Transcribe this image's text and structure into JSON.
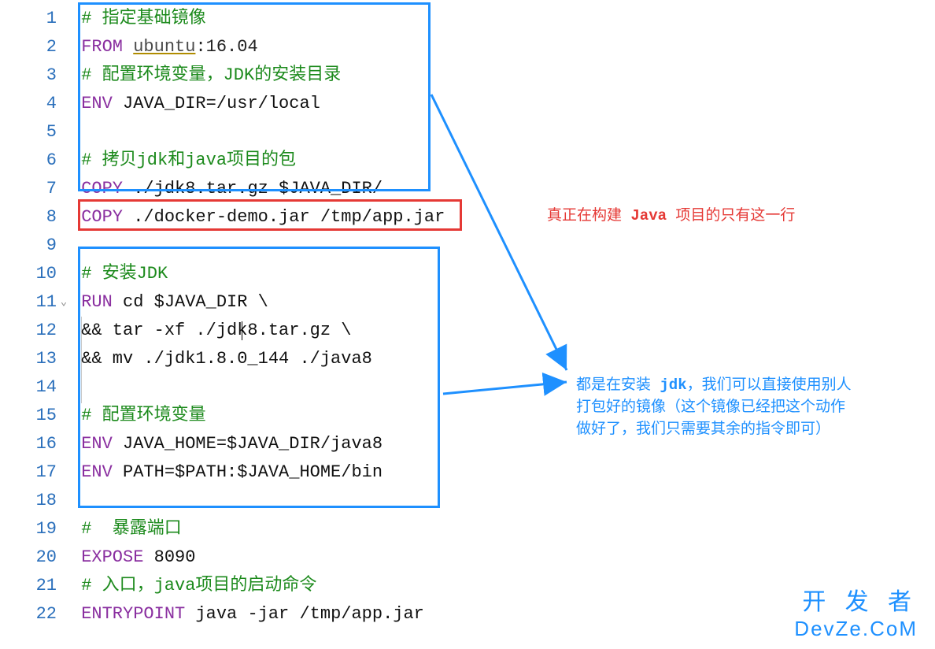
{
  "lineNumbers": [
    "1",
    "2",
    "3",
    "4",
    "5",
    "6",
    "7",
    "8",
    "9",
    "10",
    "11",
    "12",
    "13",
    "14",
    "15",
    "16",
    "17",
    "18",
    "19",
    "20",
    "21",
    "22"
  ],
  "code": {
    "l1_comment": "# 指定基础镜像",
    "l2_from": "FROM",
    "l2_image": "ubuntu",
    "l2_tag": ":16.04",
    "l3_comment": "# 配置环境变量，JDK的安装目录",
    "l4_env": "ENV",
    "l4_rest": " JAVA_DIR=/usr/local",
    "l6_comment": "# 拷贝jdk和java项目的包",
    "l7_copy": "COPY",
    "l7_rest": " ./jdk8.tar.gz $JAVA_DIR/",
    "l8_copy": "COPY",
    "l8_rest": " ./docker-demo.jar /tmp/app.jar",
    "l10_comment": "# 安装JDK",
    "l11_run": "RUN",
    "l11_rest": " cd $JAVA_DIR \\",
    "l12": " && tar -xf ./jdk8.tar.gz \\",
    "l13": " && mv ./jdk1.8.0_144 ./java8",
    "l15_comment": "# 配置环境变量",
    "l16_env": "ENV",
    "l16_rest": " JAVA_HOME=$JAVA_DIR/java8",
    "l17_env": "ENV",
    "l17_rest": " PATH=$PATH:$JAVA_HOME/bin",
    "l19_comment": "#  暴露端口",
    "l20_expose": "EXPOSE",
    "l20_rest": " 8090",
    "l21_comment": "# 入口，java项目的启动命令",
    "l22_ep": "ENTRYPOINT",
    "l22_rest": " java -jar /tmp/app.jar"
  },
  "annotations": {
    "red_prefix": "真正在构建 ",
    "red_bold": "Java",
    "red_suffix": " 项目的只有这一行",
    "blue_line1_prefix": "都是在安装 ",
    "blue_line1_bold": "jdk",
    "blue_line1_suffix": "，我们可以直接使用别人",
    "blue_line2": "打包好的镜像（这个镜像已经把这个动作",
    "blue_line3": "做好了，我们只需要其余的指令即可）"
  },
  "watermark": {
    "line1": "开 发 者",
    "line2": "DevZe.CoM"
  }
}
